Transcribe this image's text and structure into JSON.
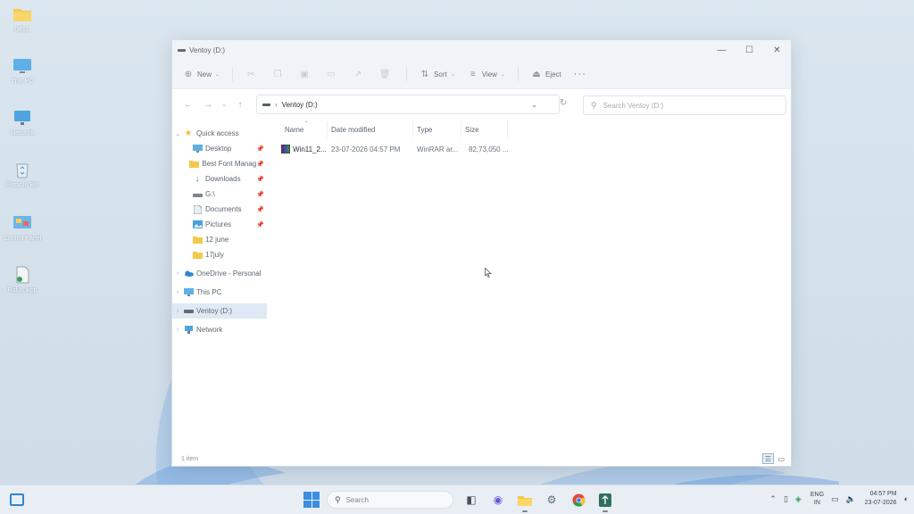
{
  "desktop": {
    "icons": [
      {
        "label": "DELL",
        "icon": "folder-icon"
      },
      {
        "label": "This PC",
        "icon": "monitor-icon"
      },
      {
        "label": "Network",
        "icon": "network-icon"
      },
      {
        "label": "Recycle Bin",
        "icon": "recycle-bin-icon"
      },
      {
        "label": "Control Panel",
        "icon": "control-panel-icon"
      },
      {
        "label": "Rufus.wbp",
        "icon": "file-icon"
      }
    ]
  },
  "window": {
    "title": "Ventoy (D:)",
    "controls": {
      "minimize": "—",
      "maximize": "☐",
      "close": "✕"
    }
  },
  "commandbar": {
    "new_label": "New",
    "sort_label": "Sort",
    "view_label": "View",
    "eject_label": "Eject",
    "more_label": "···"
  },
  "address": {
    "crumb": "Ventoy (D:)",
    "search_placeholder": "Search Ventoy (D:)"
  },
  "navpane": {
    "quick_access": "Quick access",
    "pinned": [
      {
        "label": "Desktop",
        "icon": "desktop-icon",
        "pinned": true
      },
      {
        "label": "Best Font Manag",
        "icon": "folder-icon",
        "pinned": true
      },
      {
        "label": "Downloads",
        "icon": "download-icon",
        "pinned": true
      },
      {
        "label": "G:\\",
        "icon": "drive-icon",
        "pinned": true
      },
      {
        "label": "Documents",
        "icon": "documents-icon",
        "pinned": true
      },
      {
        "label": "Pictures",
        "icon": "pictures-icon",
        "pinned": true
      },
      {
        "label": "12 june",
        "icon": "folder-icon",
        "pinned": false
      },
      {
        "label": "17july",
        "icon": "folder-icon",
        "pinned": false
      }
    ],
    "onedrive": "OneDrive - Personal",
    "thispc": "This PC",
    "ventoy": "Ventoy (D:)",
    "network": "Network"
  },
  "columns": {
    "name": "Name",
    "date": "Date modified",
    "type": "Type",
    "size": "Size"
  },
  "files": [
    {
      "name": "Win11_2...",
      "date": "23-07-2026 04:57 PM",
      "type": "WinRAR ar...",
      "size": "82,73,050 ..."
    }
  ],
  "status": {
    "count": "1 item"
  },
  "taskbar": {
    "search_label": "Search",
    "lang_top": "ENG",
    "lang_bottom": "IN",
    "time": "04:57 PM",
    "date": "23-07-2026"
  },
  "colors": {
    "accent": "#2f86d2",
    "selection": "#dfe9f5"
  }
}
